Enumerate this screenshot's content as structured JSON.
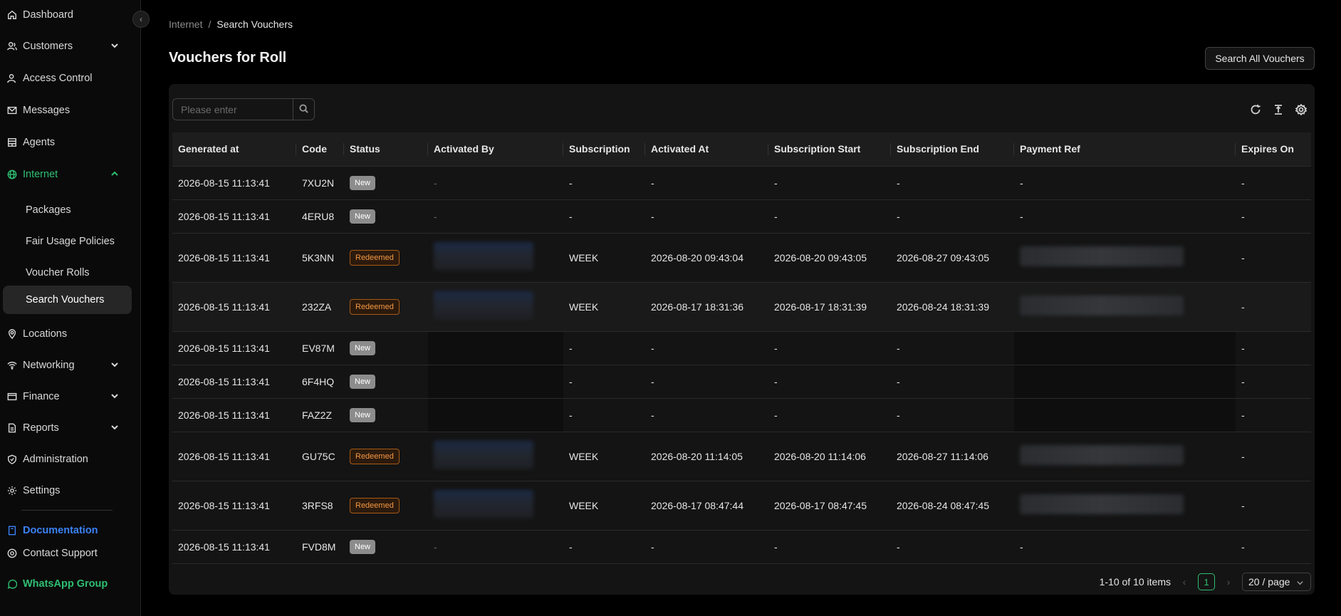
{
  "sidebar": {
    "items": [
      {
        "label": "Dashboard",
        "icon": "home-icon"
      },
      {
        "label": "Customers",
        "icon": "users-icon"
      },
      {
        "label": "Access Control",
        "icon": "user-lock-icon"
      },
      {
        "label": "Messages",
        "icon": "mail-icon"
      },
      {
        "label": "Agents",
        "icon": "store-icon"
      },
      {
        "label": "Internet",
        "icon": "globe-icon"
      },
      {
        "label": "Packages"
      },
      {
        "label": "Fair Usage Policies"
      },
      {
        "label": "Voucher Rolls"
      },
      {
        "label": "Search Vouchers"
      },
      {
        "label": "Locations",
        "icon": "location-pin-icon"
      },
      {
        "label": "Networking",
        "icon": "wifi-icon"
      },
      {
        "label": "Finance",
        "icon": "wallet-icon"
      },
      {
        "label": "Reports",
        "icon": "report-icon"
      },
      {
        "label": "Administration",
        "icon": "shield-icon"
      },
      {
        "label": "Settings",
        "icon": "gear-icon"
      }
    ],
    "documentation": "Documentation",
    "contact_support": "Contact Support",
    "whatsapp_group": "WhatsApp Group"
  },
  "breadcrumb": {
    "parent": "Internet",
    "separator": "/",
    "current": "Search Vouchers"
  },
  "page_title": "Vouchers for Roll",
  "search_all_label": "Search All Vouchers",
  "search": {
    "placeholder": "Please enter"
  },
  "table": {
    "columns": [
      "Generated at",
      "Code",
      "Status",
      "Activated By",
      "Subscription",
      "Activated At",
      "Subscription Start",
      "Subscription End",
      "Payment Ref",
      "Expires On"
    ],
    "rows": [
      {
        "generated": "2026-08-15 11:13:41",
        "code": "7XU2N",
        "status": "New",
        "activated_by": "-",
        "subscription": "-",
        "activated_at": "-",
        "sub_start": "-",
        "sub_end": "-",
        "payment_ref": "-",
        "expires": "-"
      },
      {
        "generated": "2026-08-15 11:13:41",
        "code": "4ERU8",
        "status": "New",
        "activated_by": "-",
        "subscription": "-",
        "activated_at": "-",
        "sub_start": "-",
        "sub_end": "-",
        "payment_ref": "-",
        "expires": "-"
      },
      {
        "generated": "2026-08-15 11:13:41",
        "code": "5K3NN",
        "status": "Redeemed",
        "activated_by": "",
        "subscription": "WEEK",
        "activated_at": "2026-08-20 09:43:04",
        "sub_start": "2026-08-20 09:43:05",
        "sub_end": "2026-08-27 09:43:05",
        "payment_ref": "",
        "expires": "-"
      },
      {
        "generated": "2026-08-15 11:13:41",
        "code": "232ZA",
        "status": "Redeemed",
        "activated_by": "",
        "subscription": "WEEK",
        "activated_at": "2026-08-17 18:31:36",
        "sub_start": "2026-08-17 18:31:39",
        "sub_end": "2026-08-24 18:31:39",
        "payment_ref": "",
        "expires": "-"
      },
      {
        "generated": "2026-08-15 11:13:41",
        "code": "EV87M",
        "status": "New",
        "activated_by": "",
        "subscription": "-",
        "activated_at": "-",
        "sub_start": "-",
        "sub_end": "-",
        "payment_ref": "",
        "expires": "-"
      },
      {
        "generated": "2026-08-15 11:13:41",
        "code": "6F4HQ",
        "status": "New",
        "activated_by": "",
        "subscription": "-",
        "activated_at": "-",
        "sub_start": "-",
        "sub_end": "-",
        "payment_ref": "",
        "expires": "-"
      },
      {
        "generated": "2026-08-15 11:13:41",
        "code": "FAZ2Z",
        "status": "New",
        "activated_by": "",
        "subscription": "-",
        "activated_at": "-",
        "sub_start": "-",
        "sub_end": "-",
        "payment_ref": "",
        "expires": "-"
      },
      {
        "generated": "2026-08-15 11:13:41",
        "code": "GU75C",
        "status": "Redeemed",
        "activated_by": "",
        "subscription": "WEEK",
        "activated_at": "2026-08-20 11:14:05",
        "sub_start": "2026-08-20 11:14:06",
        "sub_end": "2026-08-27 11:14:06",
        "payment_ref": "",
        "expires": "-"
      },
      {
        "generated": "2026-08-15 11:13:41",
        "code": "3RFS8",
        "status": "Redeemed",
        "activated_by": "",
        "subscription": "WEEK",
        "activated_at": "2026-08-17 08:47:44",
        "sub_start": "2026-08-17 08:47:45",
        "sub_end": "2026-08-24 08:47:45",
        "payment_ref": "",
        "expires": "-"
      },
      {
        "generated": "2026-08-15 11:13:41",
        "code": "FVD8M",
        "status": "New",
        "activated_by": "-",
        "subscription": "-",
        "activated_at": "-",
        "sub_start": "-",
        "sub_end": "-",
        "payment_ref": "-",
        "expires": "-"
      }
    ]
  },
  "pagination": {
    "summary": "1-10 of 10 items",
    "current_page": "1",
    "page_size": "20 / page"
  },
  "colors": {
    "accent": "#2fbf71",
    "link": "#3b82f6",
    "redeemed": "#f59842"
  }
}
